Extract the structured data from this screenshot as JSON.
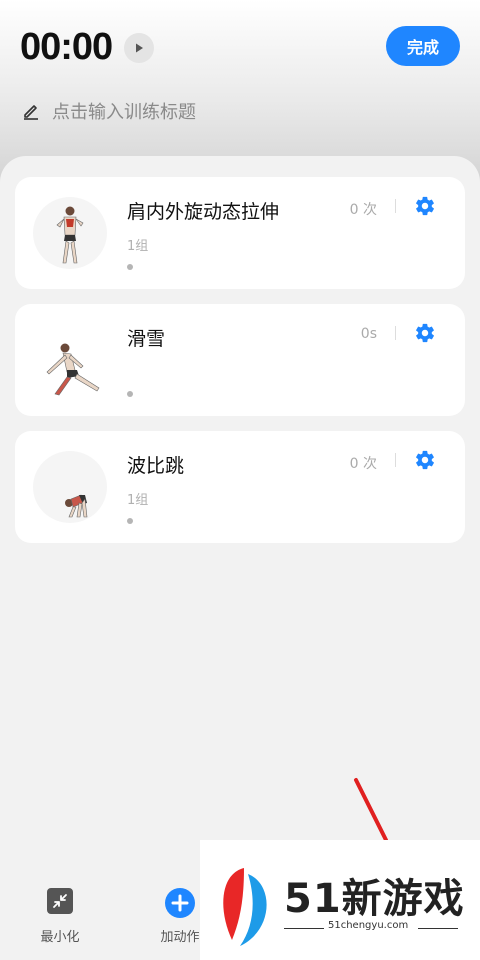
{
  "header": {
    "timer": "00:00",
    "done_label": "完成",
    "title_placeholder": "点击输入训练标题"
  },
  "exercises": [
    {
      "name": "肩内外旋动态拉伸",
      "count": "0 次",
      "sets": "1组"
    },
    {
      "name": "滑雪",
      "count": "0s",
      "sets": ""
    },
    {
      "name": "波比跳",
      "count": "0 次",
      "sets": "1组"
    }
  ],
  "bottom": {
    "minimize_label": "最小化",
    "add_label": "加动作"
  },
  "watermark": {
    "brand": "51新游戏",
    "url": "51chengyu.com"
  },
  "colors": {
    "accent": "#1f86ff",
    "background": "#f2f2f2",
    "card": "#ffffff"
  }
}
